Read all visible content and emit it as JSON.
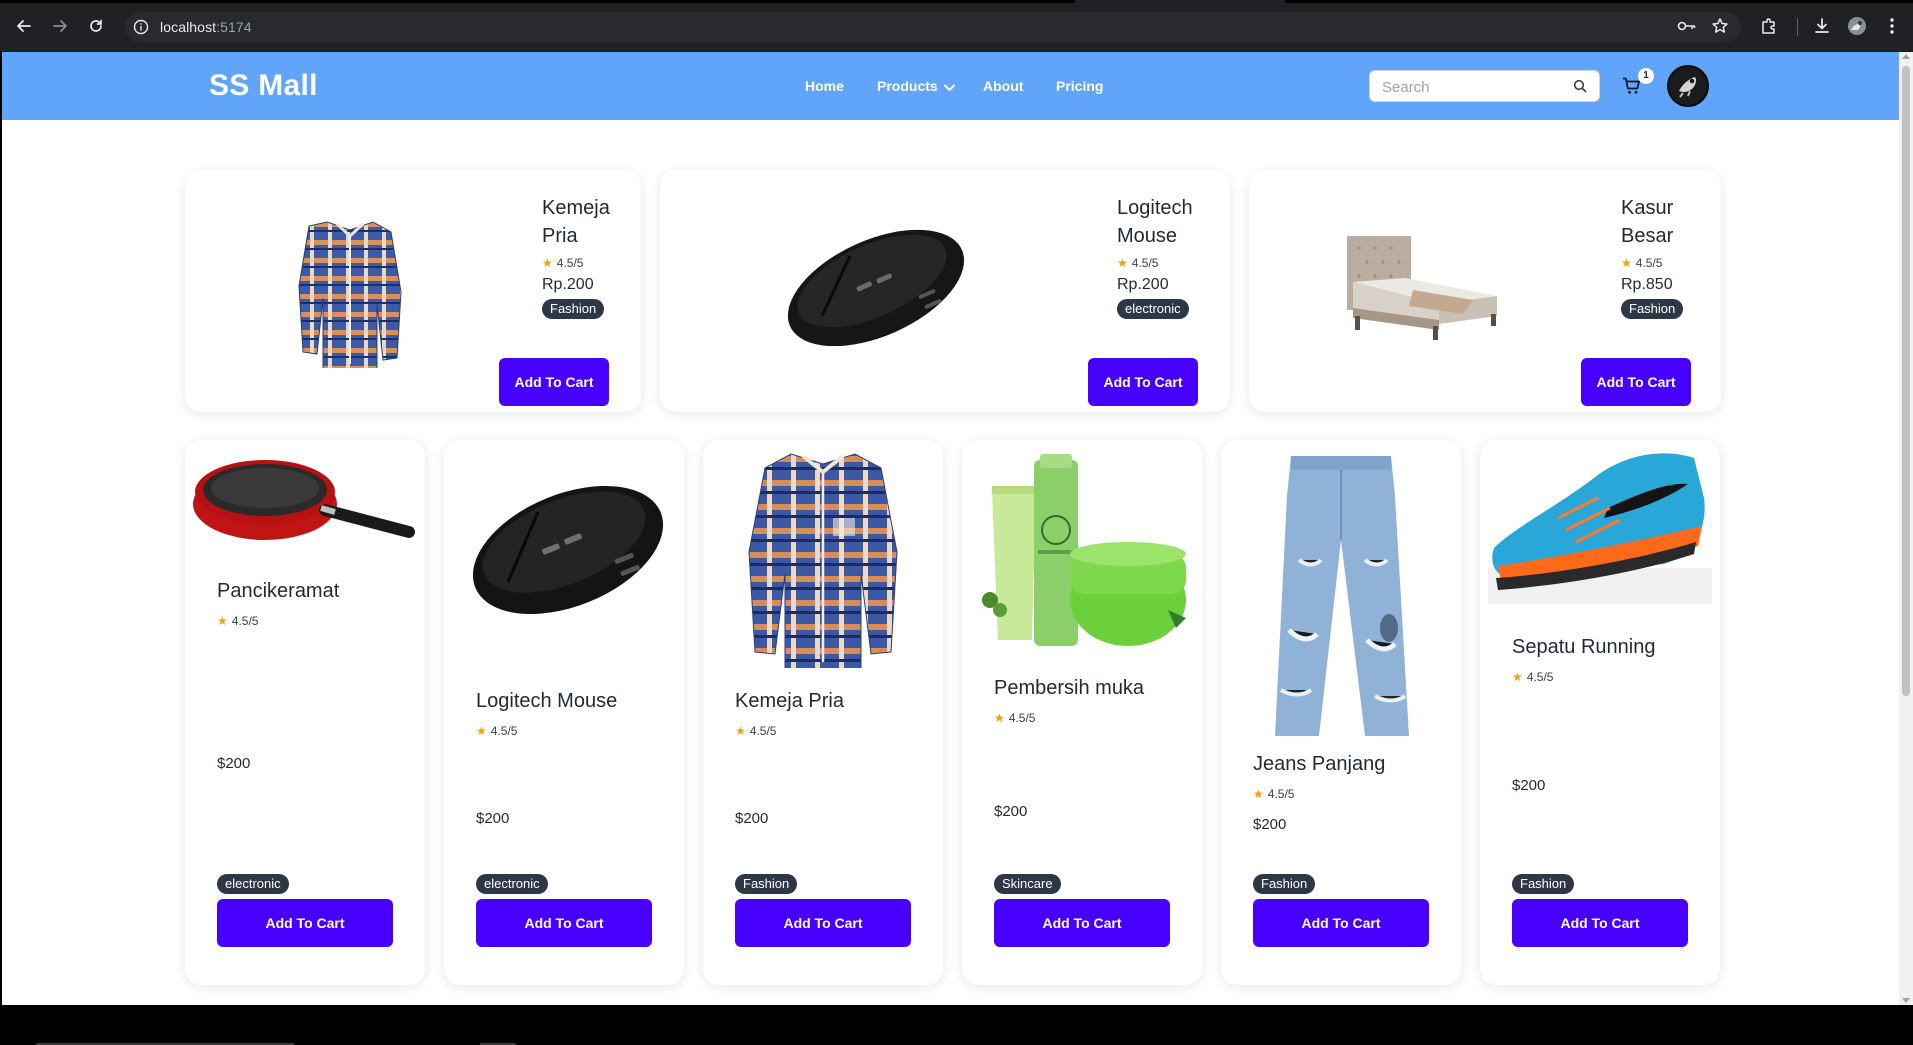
{
  "browser": {
    "url_host": "localhost",
    "url_port": ":5174"
  },
  "header": {
    "logo": "SS Mall",
    "menu": [
      {
        "label": "Home"
      },
      {
        "label": "Products"
      },
      {
        "label": "About"
      },
      {
        "label": "Pricing"
      }
    ],
    "search_placeholder": "Search",
    "cart_count": "1",
    "header_color": "#60a5fa",
    "button_color": "#4700ff"
  },
  "featured": [
    {
      "title_line1": "Kemeja",
      "title_line2": "Pria",
      "rating": "4.5/5",
      "price": "Rp.200",
      "tag": "Fashion",
      "button": "Add To Cart",
      "image": "plaid-shirt"
    },
    {
      "title_line1": "Logitech",
      "title_line2": "Mouse",
      "rating": "4.5/5",
      "price": "Rp.200",
      "tag": "electronic",
      "button": "Add To Cart",
      "image": "gaming-mouse"
    },
    {
      "title_line1": "Kasur",
      "title_line2": "Besar",
      "rating": "4.5/5",
      "price": "Rp.850",
      "tag": "Fashion",
      "button": "Add To Cart",
      "image": "bed"
    }
  ],
  "products": [
    {
      "title": "Pancikeramat",
      "rating": "4.5/5",
      "price": "$200",
      "tag": "electronic",
      "button": "Add To Cart",
      "image": "frying-pan"
    },
    {
      "title": "Logitech Mouse",
      "rating": "4.5/5",
      "price": "$200",
      "tag": "electronic",
      "button": "Add To Cart",
      "image": "gaming-mouse"
    },
    {
      "title": "Kemeja Pria",
      "rating": "4.5/5",
      "price": "$200",
      "tag": "Fashion",
      "button": "Add To Cart",
      "image": "plaid-shirt"
    },
    {
      "title": "Pembersih muka",
      "rating": "4.5/5",
      "price": "$200",
      "tag": "Skincare",
      "button": "Add To Cart",
      "image": "skincare-set"
    },
    {
      "title": "Jeans Panjang",
      "rating": "4.5/5",
      "price": "$200",
      "tag": "Fashion",
      "button": "Add To Cart",
      "image": "ripped-jeans"
    },
    {
      "title": "Sepatu Running",
      "rating": "4.5/5",
      "price": "$200",
      "tag": "Fashion",
      "button": "Add To Cart",
      "image": "running-shoe"
    }
  ]
}
